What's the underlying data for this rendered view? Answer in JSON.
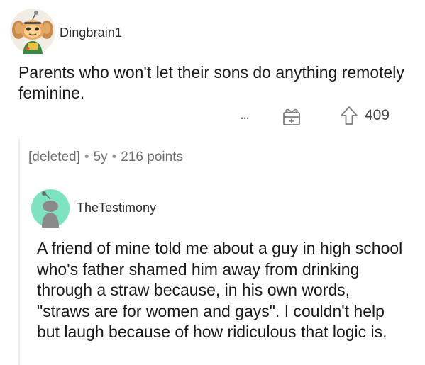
{
  "comment": {
    "username": "Dingbrain1",
    "body": "Parents who won't let their sons do anything remotely feminine.",
    "score": "409",
    "icons": {
      "more": "more-options-icon",
      "award": "award-gift-icon",
      "upvote": "upvote-arrow-icon",
      "avatar": "snoo-avatar-icon"
    },
    "more_label": "..."
  },
  "deleted": {
    "author": "[deleted]",
    "separator": "•",
    "age": "5y",
    "points": "216 points"
  },
  "reply": {
    "username": "TheTestimony",
    "body": "A friend of mine told me about a guy in high school who's father shamed him away from drinking through a straw because, in his own words, \"straws are for women and gays\". I couldn't help but laugh because of how ridiculous that logic is.",
    "avatar_bg": "#7de3c1",
    "avatar_body": "#8a8a8a"
  },
  "colors": {
    "text": "#1a1a1b",
    "meta": "#6e6e6e",
    "icon": "#7c7c7c"
  }
}
